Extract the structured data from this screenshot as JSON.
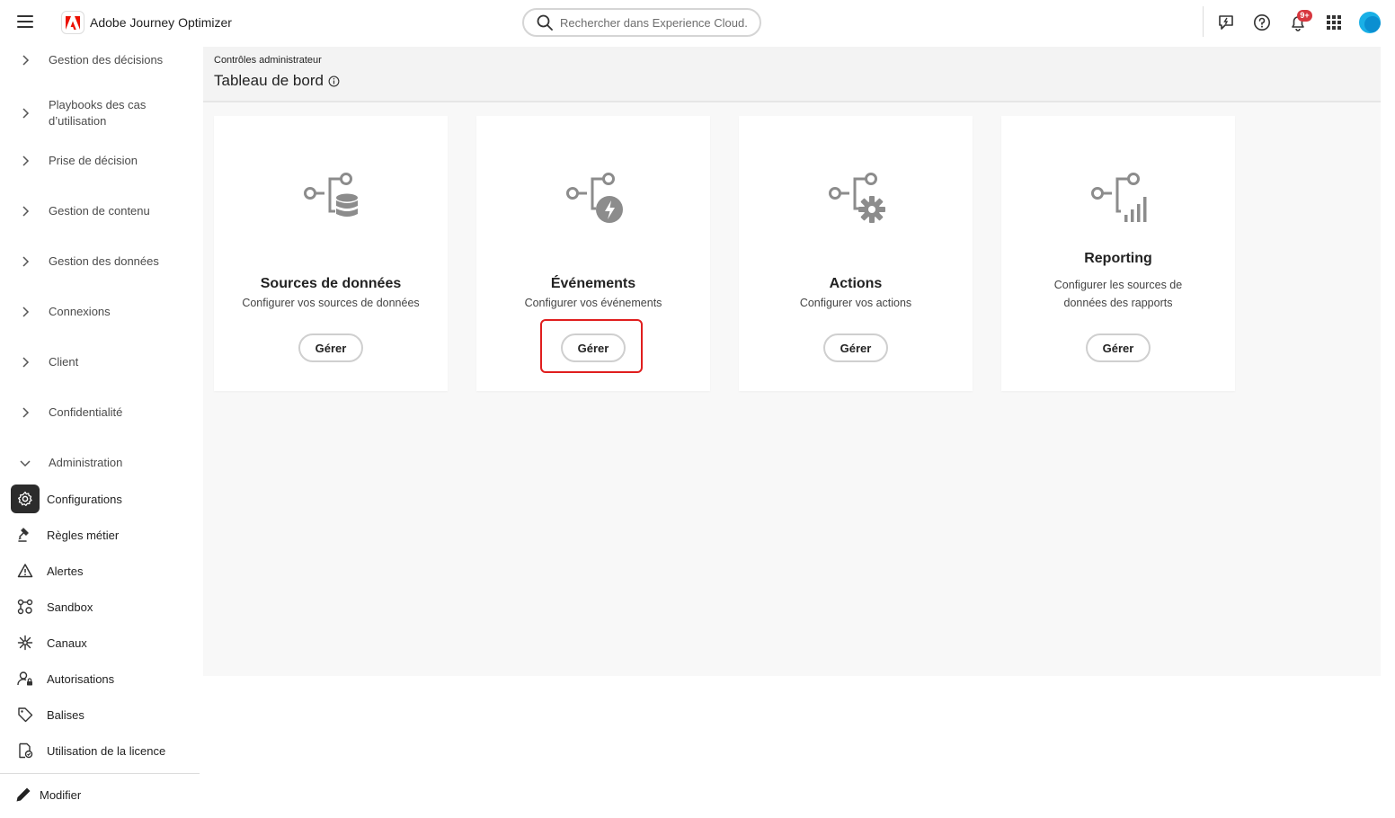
{
  "app": {
    "name": "Adobe Journey Optimizer"
  },
  "search": {
    "placeholder": "Rechercher dans Experience Cloud..."
  },
  "header": {
    "notifications_badge": "9+"
  },
  "sidebar": {
    "groups": [
      {
        "label": "Gestion des décisions"
      },
      {
        "label": "Playbooks des cas d’utilisation"
      },
      {
        "label": "Prise de décision"
      },
      {
        "label": "Gestion de contenu"
      },
      {
        "label": "Gestion des données"
      },
      {
        "label": "Connexions"
      },
      {
        "label": "Client"
      },
      {
        "label": "Confidentialité"
      },
      {
        "label": "Administration"
      }
    ],
    "items": [
      {
        "label": "Configurations",
        "icon": "gear-icon",
        "active": true
      },
      {
        "label": "Règles métier",
        "icon": "gavel-icon"
      },
      {
        "label": "Alertes",
        "icon": "alert-icon"
      },
      {
        "label": "Sandbox",
        "icon": "sandbox-icon"
      },
      {
        "label": "Canaux",
        "icon": "channels-icon"
      },
      {
        "label": "Autorisations",
        "icon": "permissions-icon"
      },
      {
        "label": "Balises",
        "icon": "tag-icon"
      },
      {
        "label": "Utilisation de la licence",
        "icon": "license-icon"
      }
    ],
    "footer": {
      "label": "Modifier"
    }
  },
  "main": {
    "breadcrumb": "Contrôles administrateur",
    "title": "Tableau de bord",
    "cards": [
      {
        "title": "Sources de données",
        "desc": "Configurer vos sources de données",
        "button": "Gérer",
        "icon": "datasource-icon"
      },
      {
        "title": "Événements",
        "desc": "Configurer vos événements",
        "button": "Gérer",
        "icon": "events-icon"
      },
      {
        "title": "Actions",
        "desc": "Configurer vos actions",
        "button": "Gérer",
        "icon": "actions-icon"
      },
      {
        "title": "Reporting",
        "desc": "Configurer les sources de données des rapports",
        "button": "Gérer",
        "icon": "reporting-icon"
      }
    ]
  },
  "colors": {
    "accent_highlight": "#e01e1e",
    "brand_red": "#eb1000",
    "badge": "#d7373f",
    "avatar": "#1ab0e6"
  }
}
